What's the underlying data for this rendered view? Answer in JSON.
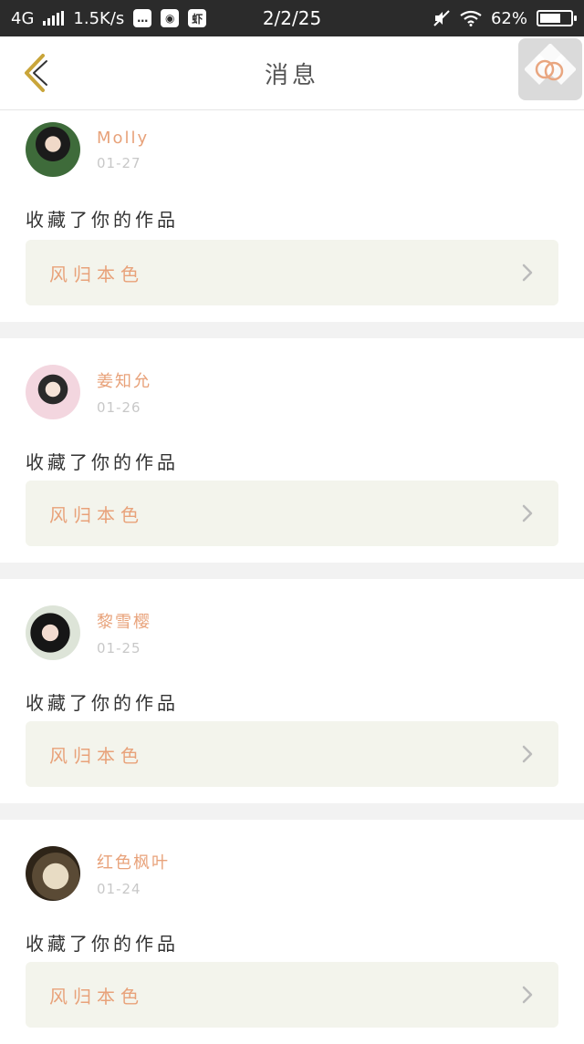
{
  "status_bar": {
    "network": "4G",
    "speed": "1.5K/s",
    "time": "2/2/25",
    "battery": "62%"
  },
  "header": {
    "title": "消息"
  },
  "notifications": [
    {
      "username": "Molly",
      "date": "01-27",
      "action": "收藏了你的作品",
      "work_title": "风归本色"
    },
    {
      "username": "姜知允",
      "date": "01-26",
      "action": "收藏了你的作品",
      "work_title": "风归本色"
    },
    {
      "username": "黎雪樱",
      "date": "01-25",
      "action": "收藏了你的作品",
      "work_title": "风归本色"
    },
    {
      "username": "红色枫叶",
      "date": "01-24",
      "action": "收藏了你的作品",
      "work_title": "风归本色"
    }
  ],
  "colors": {
    "accent": "#e8a27a",
    "card_link_bg": "#f3f4ec",
    "statusbar_bg": "#2b2b2b"
  }
}
